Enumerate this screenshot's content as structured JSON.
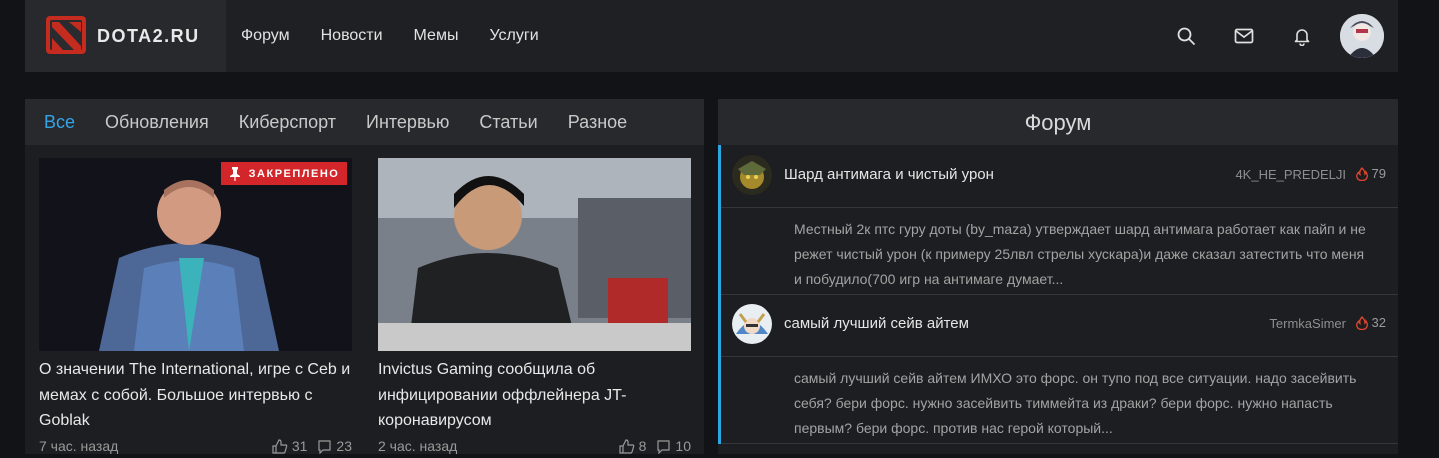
{
  "header": {
    "logo_text": "DOTA2.RU",
    "nav": [
      "Форум",
      "Новости",
      "Мемы",
      "Услуги"
    ],
    "icons": [
      "search-icon",
      "mail-icon",
      "bell-icon",
      "user-avatar"
    ],
    "accent": "#d3262a"
  },
  "news": {
    "tabs": [
      "Все",
      "Обновления",
      "Киберспорт",
      "Интервью",
      "Статьи",
      "Разное"
    ],
    "active_tab": "Все",
    "cards": [
      {
        "pinned_label": "ЗАКРЕПЛЕНО",
        "title": "О значении The International, игре с Ceb и мемах с собой. Большое интервью с Goblak",
        "time": "7 час. назад",
        "likes": "31",
        "comments": "23"
      },
      {
        "title": "Invictus Gaming сообщила об инфицировании оффлейнера JT-коронавирусом",
        "time": "2 час. назад",
        "likes": "8",
        "comments": "10"
      }
    ]
  },
  "forum": {
    "title": "Форум",
    "accent": "#2aa6e0",
    "topics": [
      {
        "title": "Шард антимага и чистый урон",
        "author": "4K_HE_PREDELJI",
        "count": "79",
        "preview": "Местный 2к птс гуру доты (by_maza) утверждает шард антимага работает как пайп и не режет чистый урон (к примеру 25лвл стрелы хускара)и даже сказал затестить что меня и побудило(700 игр на антимаге думает..."
      },
      {
        "title": "самый лучший сейв айтем",
        "author": "TermkaSimer",
        "count": "32",
        "preview": "самый лучший сейв айтем ИМХО это форс. он тупо под все ситуации. надо засейвить себя? бери форс. нужно засейвить тиммейта из драки? бери форс. нужно напасть первым? бери форс. против нас герой который..."
      }
    ]
  }
}
